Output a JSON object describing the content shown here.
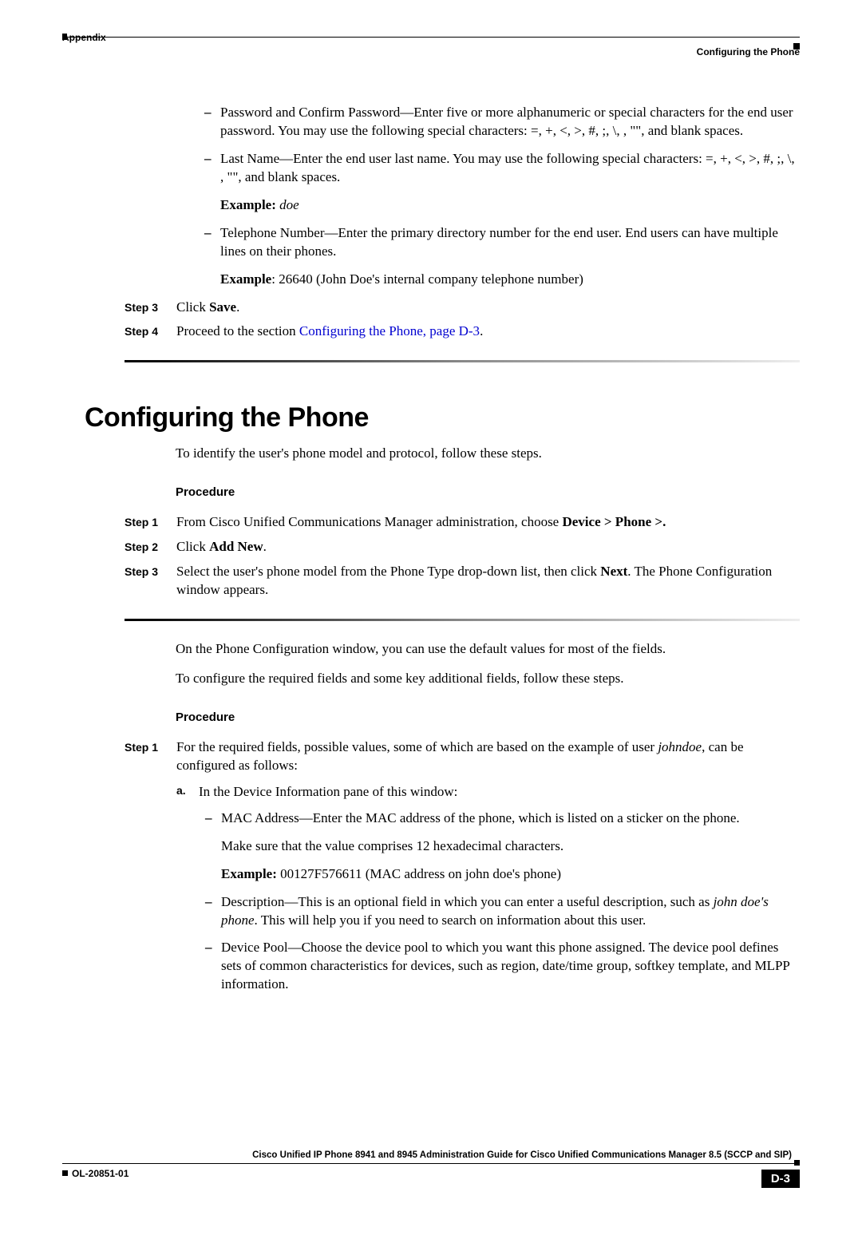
{
  "header": {
    "left": "Appendix",
    "right": "Configuring the Phone"
  },
  "top_bullets": {
    "b1": "Password and Confirm Password—Enter five or more alphanumeric or special characters for the end user password. You may use the following special characters: =, +, <, >, #, ;, \\, , \"\", and blank spaces.",
    "b2": "Last Name—Enter the end user last name. You may use the following special characters: =, +, <, >, #, ;, \\, , \"\", and blank spaces.",
    "example1_label": "Example:",
    "example1_val": " doe",
    "b3": "Telephone Number—Enter the primary directory number for the end user. End users can have multiple lines on their phones.",
    "example2_label": "Example",
    "example2_val": ": 26640 (John Doe's internal company telephone number)"
  },
  "steps_a": {
    "s3_label": "Step 3",
    "s3_pre": "Click ",
    "s3_bold": "Save",
    "s3_post": ".",
    "s4_label": "Step 4",
    "s4_pre": "Proceed to the section ",
    "s4_link": "Configuring the Phone, page D-3",
    "s4_post": "."
  },
  "section_title": "Configuring the Phone",
  "intro": "To identify the user's phone model and protocol, follow these steps.",
  "procedure_label": "Procedure",
  "steps_b": {
    "s1_label": "Step 1",
    "s1_pre": "From Cisco Unified Communications Manager administration, choose ",
    "s1_bold": "Device > Phone >.",
    "s2_label": "Step 2",
    "s2_pre": "Click ",
    "s2_bold": "Add New",
    "s2_post": ".",
    "s3_label": "Step 3",
    "s3_pre": "Select the user's phone model from the Phone Type drop-down list, then click ",
    "s3_bold": "Next",
    "s3_post": ". The Phone Configuration window appears."
  },
  "mid_para1": "On the Phone Configuration window, you can use the default values for most of the fields.",
  "mid_para2": "To configure the required fields and some key additional fields, follow these steps.",
  "steps_c": {
    "s1_label": "Step 1",
    "s1_pre": "For the required fields, possible values, some of which are based on the example of user ",
    "s1_italic": "johndoe",
    "s1_post": ", can be configured as follows:",
    "a_marker": "a.",
    "a_text": "In the Device Information pane of this window:",
    "a_b1": "MAC Address—Enter the MAC address of the phone, which is listed on a sticker on the phone.",
    "a_b1_sub": "Make sure that the value comprises 12 hexadecimal characters.",
    "a_b1_ex_label": "Example:",
    "a_b1_ex_val": " 00127F576611 (MAC address on john doe's phone)",
    "a_b2_pre": "Description—This is an optional field in which you can enter a useful description, such as ",
    "a_b2_italic": "john doe's phone",
    "a_b2_post": ". This will help you if you need to search on information about this user.",
    "a_b3": "Device Pool—Choose the device pool to which you want this phone assigned. The device pool defines sets of common characteristics for devices, such as region, date/time group, softkey template, and MLPP information."
  },
  "footer": {
    "title": "Cisco Unified IP Phone 8941 and 8945 Administration Guide for Cisco Unified Communications Manager 8.5 (SCCP and SIP)",
    "docid": "OL-20851-01",
    "pagenum": "D-3"
  }
}
